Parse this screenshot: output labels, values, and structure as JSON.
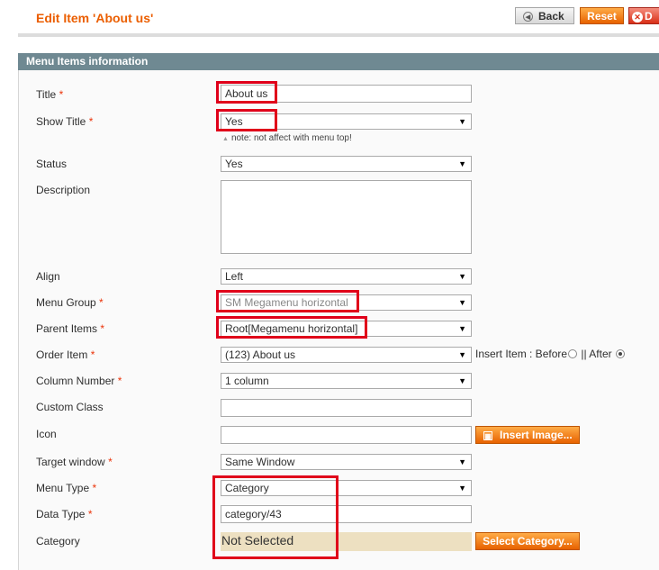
{
  "header": {
    "title": "Edit Item 'About us'",
    "back_label": "Back",
    "reset_label": "Reset",
    "delete_label": "D",
    "back_icon": "back-arrow-icon",
    "delete_icon": "close-icon"
  },
  "section": {
    "title": "Menu Items information"
  },
  "fields": {
    "title": {
      "label": "Title",
      "required": "*",
      "value": "About us"
    },
    "show_title": {
      "label": "Show Title",
      "required": "*",
      "value": "Yes",
      "note": "note: not affect with menu top!"
    },
    "status": {
      "label": "Status",
      "value": "Yes"
    },
    "description": {
      "label": "Description",
      "value": ""
    },
    "align": {
      "label": "Align",
      "value": "Left"
    },
    "menu_group": {
      "label": "Menu Group",
      "required": "*",
      "value": "SM Megamenu horizontal"
    },
    "parent_items": {
      "label": "Parent Items",
      "required": "*",
      "value": "Root[Megamenu horizontal]"
    },
    "order_item": {
      "label": "Order Item",
      "required": "*",
      "value": "(123) About us",
      "insert_label": "Insert Item : Before",
      "separator": "||",
      "after_label": "After",
      "selected": "After"
    },
    "column_number": {
      "label": "Column Number",
      "required": "*",
      "value": "1 column"
    },
    "custom_class": {
      "label": "Custom Class",
      "value": ""
    },
    "icon": {
      "label": "Icon",
      "value": "",
      "button_label": "Insert Image..."
    },
    "target_window": {
      "label": "Target window",
      "required": "*",
      "value": "Same Window"
    },
    "menu_type": {
      "label": "Menu Type",
      "required": "*",
      "value": "Category"
    },
    "data_type": {
      "label": "Data Type",
      "required": "*",
      "value": "category/43"
    },
    "category": {
      "label": "Category",
      "value": "Not Selected",
      "button_label": "Select Category..."
    }
  },
  "colors": {
    "accent": "#eb5e00",
    "section_header": "#6f8992",
    "highlight": "#e0001a",
    "category_bg": "#ede0c1"
  }
}
